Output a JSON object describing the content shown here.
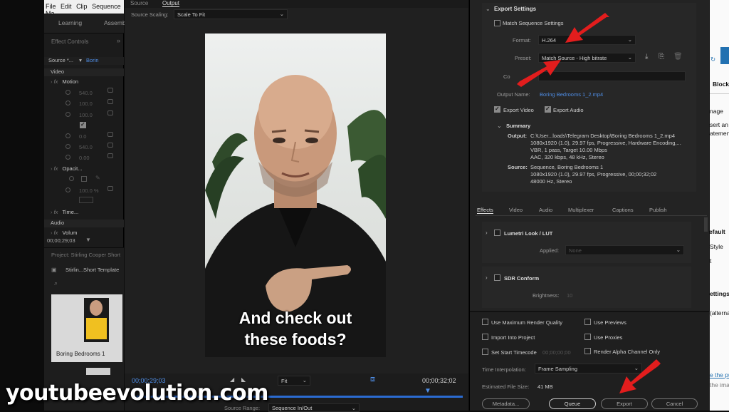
{
  "menubar": [
    "File",
    "Edit",
    "Clip",
    "Sequence",
    "Ma"
  ],
  "workspaces": [
    "Learning",
    "Assemb"
  ],
  "effect_controls": {
    "title": "Effect Controls",
    "source_label": "Source *...",
    "clip_label": "Borin",
    "video_header": "Video",
    "motion": "Motion",
    "opacity": "Opacit...",
    "time_remap": "Time...",
    "audio_header": "Audio",
    "volume": "Volum",
    "values": [
      "540.0",
      "100.0",
      "100.0",
      "0.0",
      "540.0",
      "0.00",
      "100.0 %"
    ],
    "timecode": "00;00;29;03"
  },
  "project": {
    "title": "Project: Stirling Cooper Short",
    "bin": "Stirlin...Short Template",
    "clip_name": "Boring Bedrooms 1"
  },
  "monitor": {
    "tabs": [
      "Source",
      "Output"
    ],
    "source_scaling_label": "Source Scaling:",
    "source_scaling_value": "Scale To Fit",
    "caption_line1": "And check out",
    "caption_line2": "these foods?",
    "timecode_left": "00;00;29;03",
    "fit": "Fit",
    "timecode_right": "00;00;32;02",
    "source_range_label": "Source Range:",
    "source_range_value": "Sequence In/Out"
  },
  "export": {
    "section": "Export Settings",
    "match_sequence": "Match Sequence Settings",
    "format_label": "Format:",
    "format_value": "H.264",
    "preset_label": "Preset:",
    "preset_value": "Match Source - High bitrate",
    "comments_label": "Co",
    "output_name_label": "Output Name:",
    "output_name_value": "Boring Bedrooms 1_2.mp4",
    "export_video": "Export Video",
    "export_audio": "Export Audio",
    "summary": "Summary",
    "output_label": "Output:",
    "output_lines": [
      "C:\\User...loads\\Telegram Desktop\\Boring Bedrooms 1_2.mp4",
      "1080x1920 (1.0), 29.97 fps, Progressive, Hardware Encoding,...",
      "VBR, 1 pass, Target 10.00 Mbps",
      "AAC, 320 kbps, 48 kHz, Stereo"
    ],
    "source_label": "Source:",
    "source_lines": [
      "Sequence, Boring Bedrooms 1",
      "1080x1920 (1.0), 29.97 fps, Progressive, 00;00;32;02",
      "48000 Hz, Stereo"
    ],
    "tabs": [
      "Effects",
      "Video",
      "Audio",
      "Multiplexer",
      "Captions",
      "Publish"
    ],
    "lumetri": "Lumetri Look / LUT",
    "applied_label": "Applied:",
    "applied_value": "None",
    "sdr": "SDR Conform",
    "brightness_label": "Brightness:",
    "brightness_value": "10",
    "use_max_render": "Use Maximum Render Quality",
    "use_previews": "Use Previews",
    "import_into_project": "Import Into Project",
    "use_proxies": "Use Proxies",
    "set_start_timecode": "Set Start Timecode",
    "start_timecode_value": "00;00;00;00",
    "render_alpha": "Render Alpha Channel Only",
    "time_interp_label": "Time Interpolation:",
    "time_interp_value": "Frame Sampling",
    "est_size_label": "Estimated File Size:",
    "est_size_value": "41 MB",
    "metadata_btn": "Metadata...",
    "queue_btn": "Queue",
    "export_btn": "Export",
    "cancel_btn": "Cancel"
  },
  "right_strip": [
    "Block",
    "nage",
    "sert an",
    "atemen",
    "efault",
    "Style",
    "t",
    "ettings",
    "(alterna",
    "e the pu",
    "the ima"
  ],
  "watermark": "youtubeevolution.com",
  "colors": {
    "arrow": "#e21d1d",
    "link": "#4f8ee6",
    "timeline": "#2b6bd1"
  }
}
